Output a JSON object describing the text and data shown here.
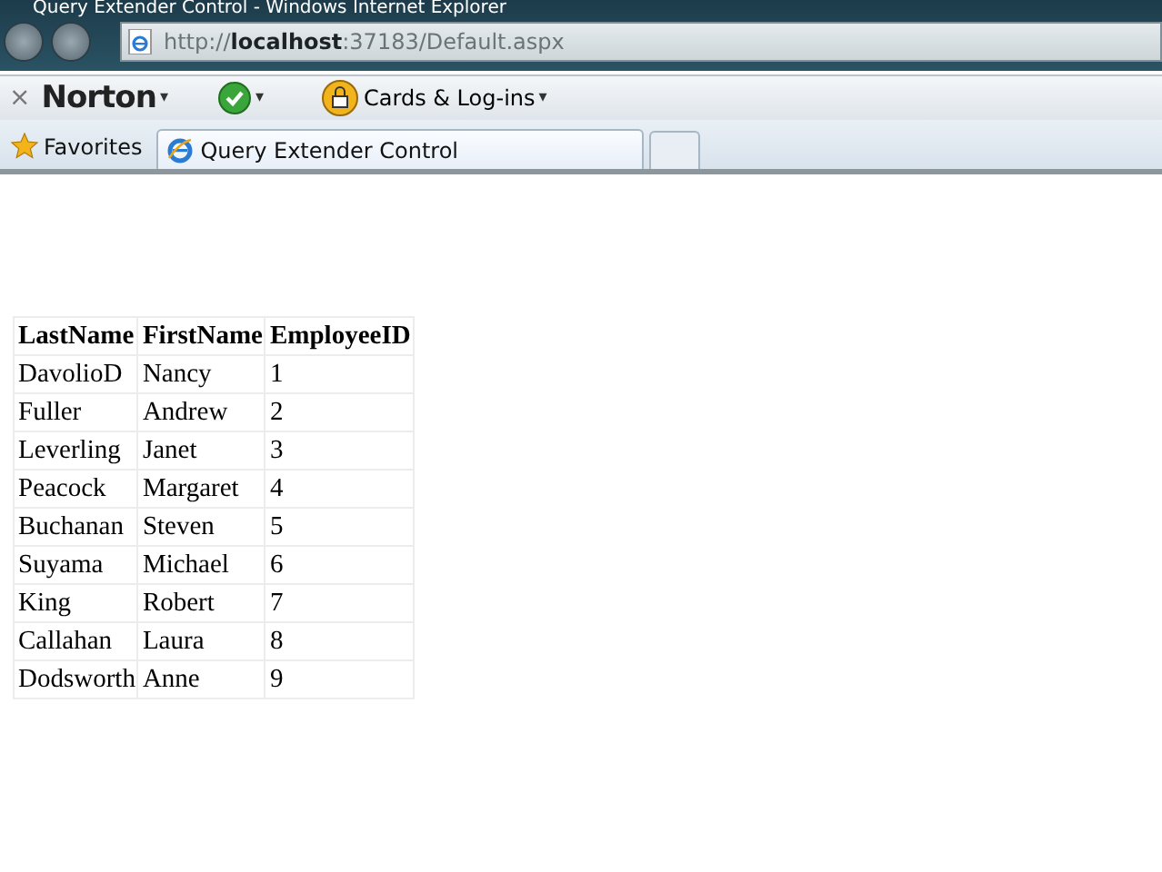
{
  "window": {
    "title": "Query Extender Control - Windows Internet Explorer"
  },
  "address_bar": {
    "url": "http://**localhost**:37183/Default.aspx"
  },
  "norton_toolbar": {
    "brand": "Norton",
    "caret": "▾",
    "cards_label": "Cards & Log-ins",
    "close": "×"
  },
  "favorites_bar": {
    "favorites": "Favorites",
    "tabs": [
      {
        "label": "Query Extender Control",
        "selected": true
      }
    ]
  },
  "table": {
    "columns": [
      "LastName",
      "FirstName",
      "EmployeeID"
    ],
    "rows": [
      [
        "DavolioD",
        "Nancy",
        "1"
      ],
      [
        "Fuller",
        "Andrew",
        "2"
      ],
      [
        "Leverling",
        "Janet",
        "3"
      ],
      [
        "Peacock",
        "Margaret",
        "4"
      ],
      [
        "Buchanan",
        "Steven",
        "5"
      ],
      [
        "Suyama",
        "Michael",
        "6"
      ],
      [
        "King",
        "Robert",
        "7"
      ],
      [
        "Callahan",
        "Laura",
        "8"
      ],
      [
        "Dodsworth",
        "Anne",
        "9"
      ]
    ]
  }
}
